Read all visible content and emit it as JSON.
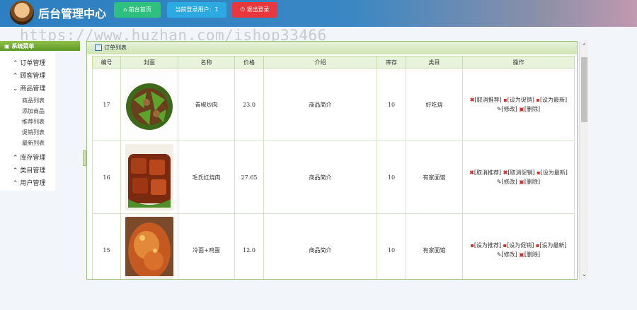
{
  "header": {
    "title": "后台管理中心",
    "home_btn": "前台首页",
    "user_btn": "当前登录用户：1",
    "logout_btn": "退出登录"
  },
  "watermark": "https://www.huzhan.com/ishop33466",
  "sidebar": {
    "title": "系统菜单",
    "items": [
      {
        "label": "订单管理"
      },
      {
        "label": "顾客管理"
      },
      {
        "label": "商品管理"
      },
      {
        "label": "商品列表"
      },
      {
        "label": "添加商品"
      },
      {
        "label": "推荐列表"
      },
      {
        "label": "促销列表"
      },
      {
        "label": "最新列表"
      },
      {
        "label": "库存管理"
      },
      {
        "label": "类目管理"
      },
      {
        "label": "用户管理"
      }
    ]
  },
  "panel": {
    "title": "订单列表"
  },
  "table": {
    "headers": [
      "编号",
      "封面",
      "名称",
      "价格",
      "介绍",
      "库存",
      "类目",
      "操作"
    ],
    "rows": [
      {
        "id": "17",
        "name": "青椒炒肉",
        "price": "23.0",
        "intro": "商品简介",
        "stock": "10",
        "category": "好吃烧",
        "op1": "[取消推荐]",
        "op2": "[设为促销]",
        "op3": "[设为最新]",
        "op4": "[修改]",
        "op5": "[删除]",
        "op1_icon": "x"
      },
      {
        "id": "16",
        "name": "毛氏红烧肉",
        "price": "27.65",
        "intro": "商品简介",
        "stock": "10",
        "category": "有家面馆",
        "op1": "[取消推荐]",
        "op2": "[取消促销]",
        "op3": "[设为最新]",
        "op4": "[修改]",
        "op5": "[删除]",
        "op1_icon": "x"
      },
      {
        "id": "15",
        "name": "冷面+鸡蛋",
        "price": "12.0",
        "intro": "商品简介",
        "stock": "10",
        "category": "有家面馆",
        "op1": "[设为推荐]",
        "op2": "[设为促销]",
        "op3": "[设为最新]",
        "op4": "[修改]",
        "op5": "[删除]",
        "op1_icon": "sq"
      }
    ]
  },
  "colors": {
    "header": "#2c7fc0",
    "green_btn": "#2fbf7f",
    "blue_btn": "#2ca9e1",
    "red_btn": "#e8383d",
    "panel_border": "#9cc07a"
  }
}
